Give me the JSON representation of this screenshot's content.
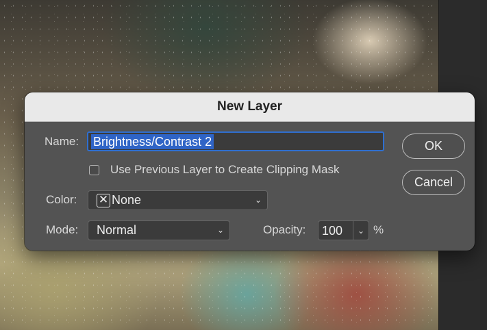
{
  "dialog": {
    "title": "New Layer",
    "name_label": "Name:",
    "name_value": "Brightness/Contrast 2",
    "clipping_label": "Use Previous Layer to Create Clipping Mask",
    "clipping_checked": false,
    "color_label": "Color:",
    "color_value": "None",
    "mode_label": "Mode:",
    "mode_value": "Normal",
    "opacity_label": "Opacity:",
    "opacity_value": "100",
    "opacity_unit": "%",
    "ok_label": "OK",
    "cancel_label": "Cancel"
  },
  "icons": {
    "none_swatch": "x-box-icon",
    "dropdown": "chevron-down-icon"
  },
  "colors": {
    "dialog_bg": "#535353",
    "title_bar_bg": "#e9e9e9",
    "selection": "#2f64c6",
    "focus_ring": "#2f6fd0"
  }
}
